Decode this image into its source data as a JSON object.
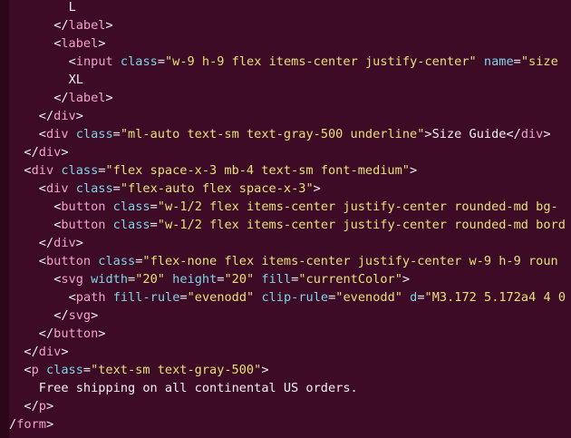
{
  "editor": {
    "colors": {
      "background": "#3e0b27",
      "tag": "#f0a2c8",
      "attribute": "#7ed4e6",
      "string": "#e6e07a",
      "text": "#f2f0ee"
    },
    "lines": [
      {
        "indent": 4,
        "tokens": [
          {
            "t": "txt",
            "v": "L"
          }
        ]
      },
      {
        "indent": 3,
        "tokens": [
          {
            "t": "punct",
            "v": "</"
          },
          {
            "t": "tag",
            "v": "label"
          },
          {
            "t": "punct",
            "v": ">"
          }
        ]
      },
      {
        "indent": 3,
        "tokens": [
          {
            "t": "punct",
            "v": "<"
          },
          {
            "t": "tag",
            "v": "label"
          },
          {
            "t": "punct",
            "v": ">"
          }
        ]
      },
      {
        "indent": 4,
        "tokens": [
          {
            "t": "punct",
            "v": "<"
          },
          {
            "t": "tag",
            "v": "input"
          },
          {
            "t": "punct",
            "v": " "
          },
          {
            "t": "attr",
            "v": "class"
          },
          {
            "t": "punct",
            "v": "="
          },
          {
            "t": "str",
            "v": "\"w-9 h-9 flex items-center justify-center\""
          },
          {
            "t": "punct",
            "v": " "
          },
          {
            "t": "attr",
            "v": "name"
          },
          {
            "t": "punct",
            "v": "="
          },
          {
            "t": "str",
            "v": "\"size"
          }
        ]
      },
      {
        "indent": 4,
        "tokens": [
          {
            "t": "txt",
            "v": "XL"
          }
        ]
      },
      {
        "indent": 3,
        "tokens": [
          {
            "t": "punct",
            "v": "</"
          },
          {
            "t": "tag",
            "v": "label"
          },
          {
            "t": "punct",
            "v": ">"
          }
        ]
      },
      {
        "indent": 2,
        "tokens": [
          {
            "t": "punct",
            "v": "</"
          },
          {
            "t": "tag",
            "v": "div"
          },
          {
            "t": "punct",
            "v": ">"
          }
        ]
      },
      {
        "indent": 2,
        "tokens": [
          {
            "t": "punct",
            "v": "<"
          },
          {
            "t": "tag",
            "v": "div"
          },
          {
            "t": "punct",
            "v": " "
          },
          {
            "t": "attr",
            "v": "class"
          },
          {
            "t": "punct",
            "v": "="
          },
          {
            "t": "str",
            "v": "\"ml-auto text-sm text-gray-500 underline\""
          },
          {
            "t": "punct",
            "v": ">"
          },
          {
            "t": "txt",
            "v": "Size Guide"
          },
          {
            "t": "punct",
            "v": "</"
          },
          {
            "t": "tag",
            "v": "div"
          },
          {
            "t": "punct",
            "v": ">"
          }
        ]
      },
      {
        "indent": 1,
        "tokens": [
          {
            "t": "punct",
            "v": "</"
          },
          {
            "t": "tag",
            "v": "div"
          },
          {
            "t": "punct",
            "v": ">"
          }
        ]
      },
      {
        "indent": 1,
        "tokens": [
          {
            "t": "punct",
            "v": "<"
          },
          {
            "t": "tag",
            "v": "div"
          },
          {
            "t": "punct",
            "v": " "
          },
          {
            "t": "attr",
            "v": "class"
          },
          {
            "t": "punct",
            "v": "="
          },
          {
            "t": "str",
            "v": "\"flex space-x-3 mb-4 text-sm font-medium\""
          },
          {
            "t": "punct",
            "v": ">"
          }
        ]
      },
      {
        "indent": 2,
        "tokens": [
          {
            "t": "punct",
            "v": "<"
          },
          {
            "t": "tag",
            "v": "div"
          },
          {
            "t": "punct",
            "v": " "
          },
          {
            "t": "attr",
            "v": "class"
          },
          {
            "t": "punct",
            "v": "="
          },
          {
            "t": "str",
            "v": "\"flex-auto flex space-x-3\""
          },
          {
            "t": "punct",
            "v": ">"
          }
        ]
      },
      {
        "indent": 3,
        "tokens": [
          {
            "t": "punct",
            "v": "<"
          },
          {
            "t": "tag",
            "v": "button"
          },
          {
            "t": "punct",
            "v": " "
          },
          {
            "t": "attr",
            "v": "class"
          },
          {
            "t": "punct",
            "v": "="
          },
          {
            "t": "str",
            "v": "\"w-1/2 flex items-center justify-center rounded-md bg-"
          }
        ]
      },
      {
        "indent": 3,
        "tokens": [
          {
            "t": "punct",
            "v": "<"
          },
          {
            "t": "tag",
            "v": "button"
          },
          {
            "t": "punct",
            "v": " "
          },
          {
            "t": "attr",
            "v": "class"
          },
          {
            "t": "punct",
            "v": "="
          },
          {
            "t": "str",
            "v": "\"w-1/2 flex items-center justify-center rounded-md bord"
          }
        ]
      },
      {
        "indent": 2,
        "tokens": [
          {
            "t": "punct",
            "v": "</"
          },
          {
            "t": "tag",
            "v": "div"
          },
          {
            "t": "punct",
            "v": ">"
          }
        ]
      },
      {
        "indent": 2,
        "tokens": [
          {
            "t": "punct",
            "v": "<"
          },
          {
            "t": "tag",
            "v": "button"
          },
          {
            "t": "punct",
            "v": " "
          },
          {
            "t": "attr",
            "v": "class"
          },
          {
            "t": "punct",
            "v": "="
          },
          {
            "t": "str",
            "v": "\"flex-none flex items-center justify-center w-9 h-9 roun"
          }
        ]
      },
      {
        "indent": 3,
        "tokens": [
          {
            "t": "punct",
            "v": "<"
          },
          {
            "t": "tag",
            "v": "svg"
          },
          {
            "t": "punct",
            "v": " "
          },
          {
            "t": "attr",
            "v": "width"
          },
          {
            "t": "punct",
            "v": "="
          },
          {
            "t": "str",
            "v": "\"20\""
          },
          {
            "t": "punct",
            "v": " "
          },
          {
            "t": "attr",
            "v": "height"
          },
          {
            "t": "punct",
            "v": "="
          },
          {
            "t": "str",
            "v": "\"20\""
          },
          {
            "t": "punct",
            "v": " "
          },
          {
            "t": "attr",
            "v": "fill"
          },
          {
            "t": "punct",
            "v": "="
          },
          {
            "t": "str",
            "v": "\"currentColor\""
          },
          {
            "t": "punct",
            "v": ">"
          }
        ]
      },
      {
        "indent": 4,
        "tokens": [
          {
            "t": "punct",
            "v": "<"
          },
          {
            "t": "tag",
            "v": "path"
          },
          {
            "t": "punct",
            "v": " "
          },
          {
            "t": "attr",
            "v": "fill-rule"
          },
          {
            "t": "punct",
            "v": "="
          },
          {
            "t": "str",
            "v": "\"evenodd\""
          },
          {
            "t": "punct",
            "v": " "
          },
          {
            "t": "attr",
            "v": "clip-rule"
          },
          {
            "t": "punct",
            "v": "="
          },
          {
            "t": "str",
            "v": "\"evenodd\""
          },
          {
            "t": "punct",
            "v": " "
          },
          {
            "t": "attr",
            "v": "d"
          },
          {
            "t": "punct",
            "v": "="
          },
          {
            "t": "str",
            "v": "\"M3.172 5.172a4 4 0"
          }
        ]
      },
      {
        "indent": 3,
        "tokens": [
          {
            "t": "punct",
            "v": "</"
          },
          {
            "t": "tag",
            "v": "svg"
          },
          {
            "t": "punct",
            "v": ">"
          }
        ]
      },
      {
        "indent": 2,
        "tokens": [
          {
            "t": "punct",
            "v": "</"
          },
          {
            "t": "tag",
            "v": "button"
          },
          {
            "t": "punct",
            "v": ">"
          }
        ]
      },
      {
        "indent": 1,
        "tokens": [
          {
            "t": "punct",
            "v": "</"
          },
          {
            "t": "tag",
            "v": "div"
          },
          {
            "t": "punct",
            "v": ">"
          }
        ]
      },
      {
        "indent": 1,
        "tokens": [
          {
            "t": "punct",
            "v": "<"
          },
          {
            "t": "tag",
            "v": "p"
          },
          {
            "t": "punct",
            "v": " "
          },
          {
            "t": "attr",
            "v": "class"
          },
          {
            "t": "punct",
            "v": "="
          },
          {
            "t": "str",
            "v": "\"text-sm text-gray-500\""
          },
          {
            "t": "punct",
            "v": ">"
          }
        ]
      },
      {
        "indent": 2,
        "tokens": [
          {
            "t": "txt",
            "v": "Free shipping on all continental US orders."
          }
        ]
      },
      {
        "indent": 1,
        "tokens": [
          {
            "t": "punct",
            "v": "</"
          },
          {
            "t": "tag",
            "v": "p"
          },
          {
            "t": "punct",
            "v": ">"
          }
        ]
      },
      {
        "indent": 0,
        "tokens": [
          {
            "t": "punct",
            "v": "/"
          },
          {
            "t": "tag",
            "v": "form"
          },
          {
            "t": "punct",
            "v": ">"
          }
        ]
      }
    ]
  }
}
